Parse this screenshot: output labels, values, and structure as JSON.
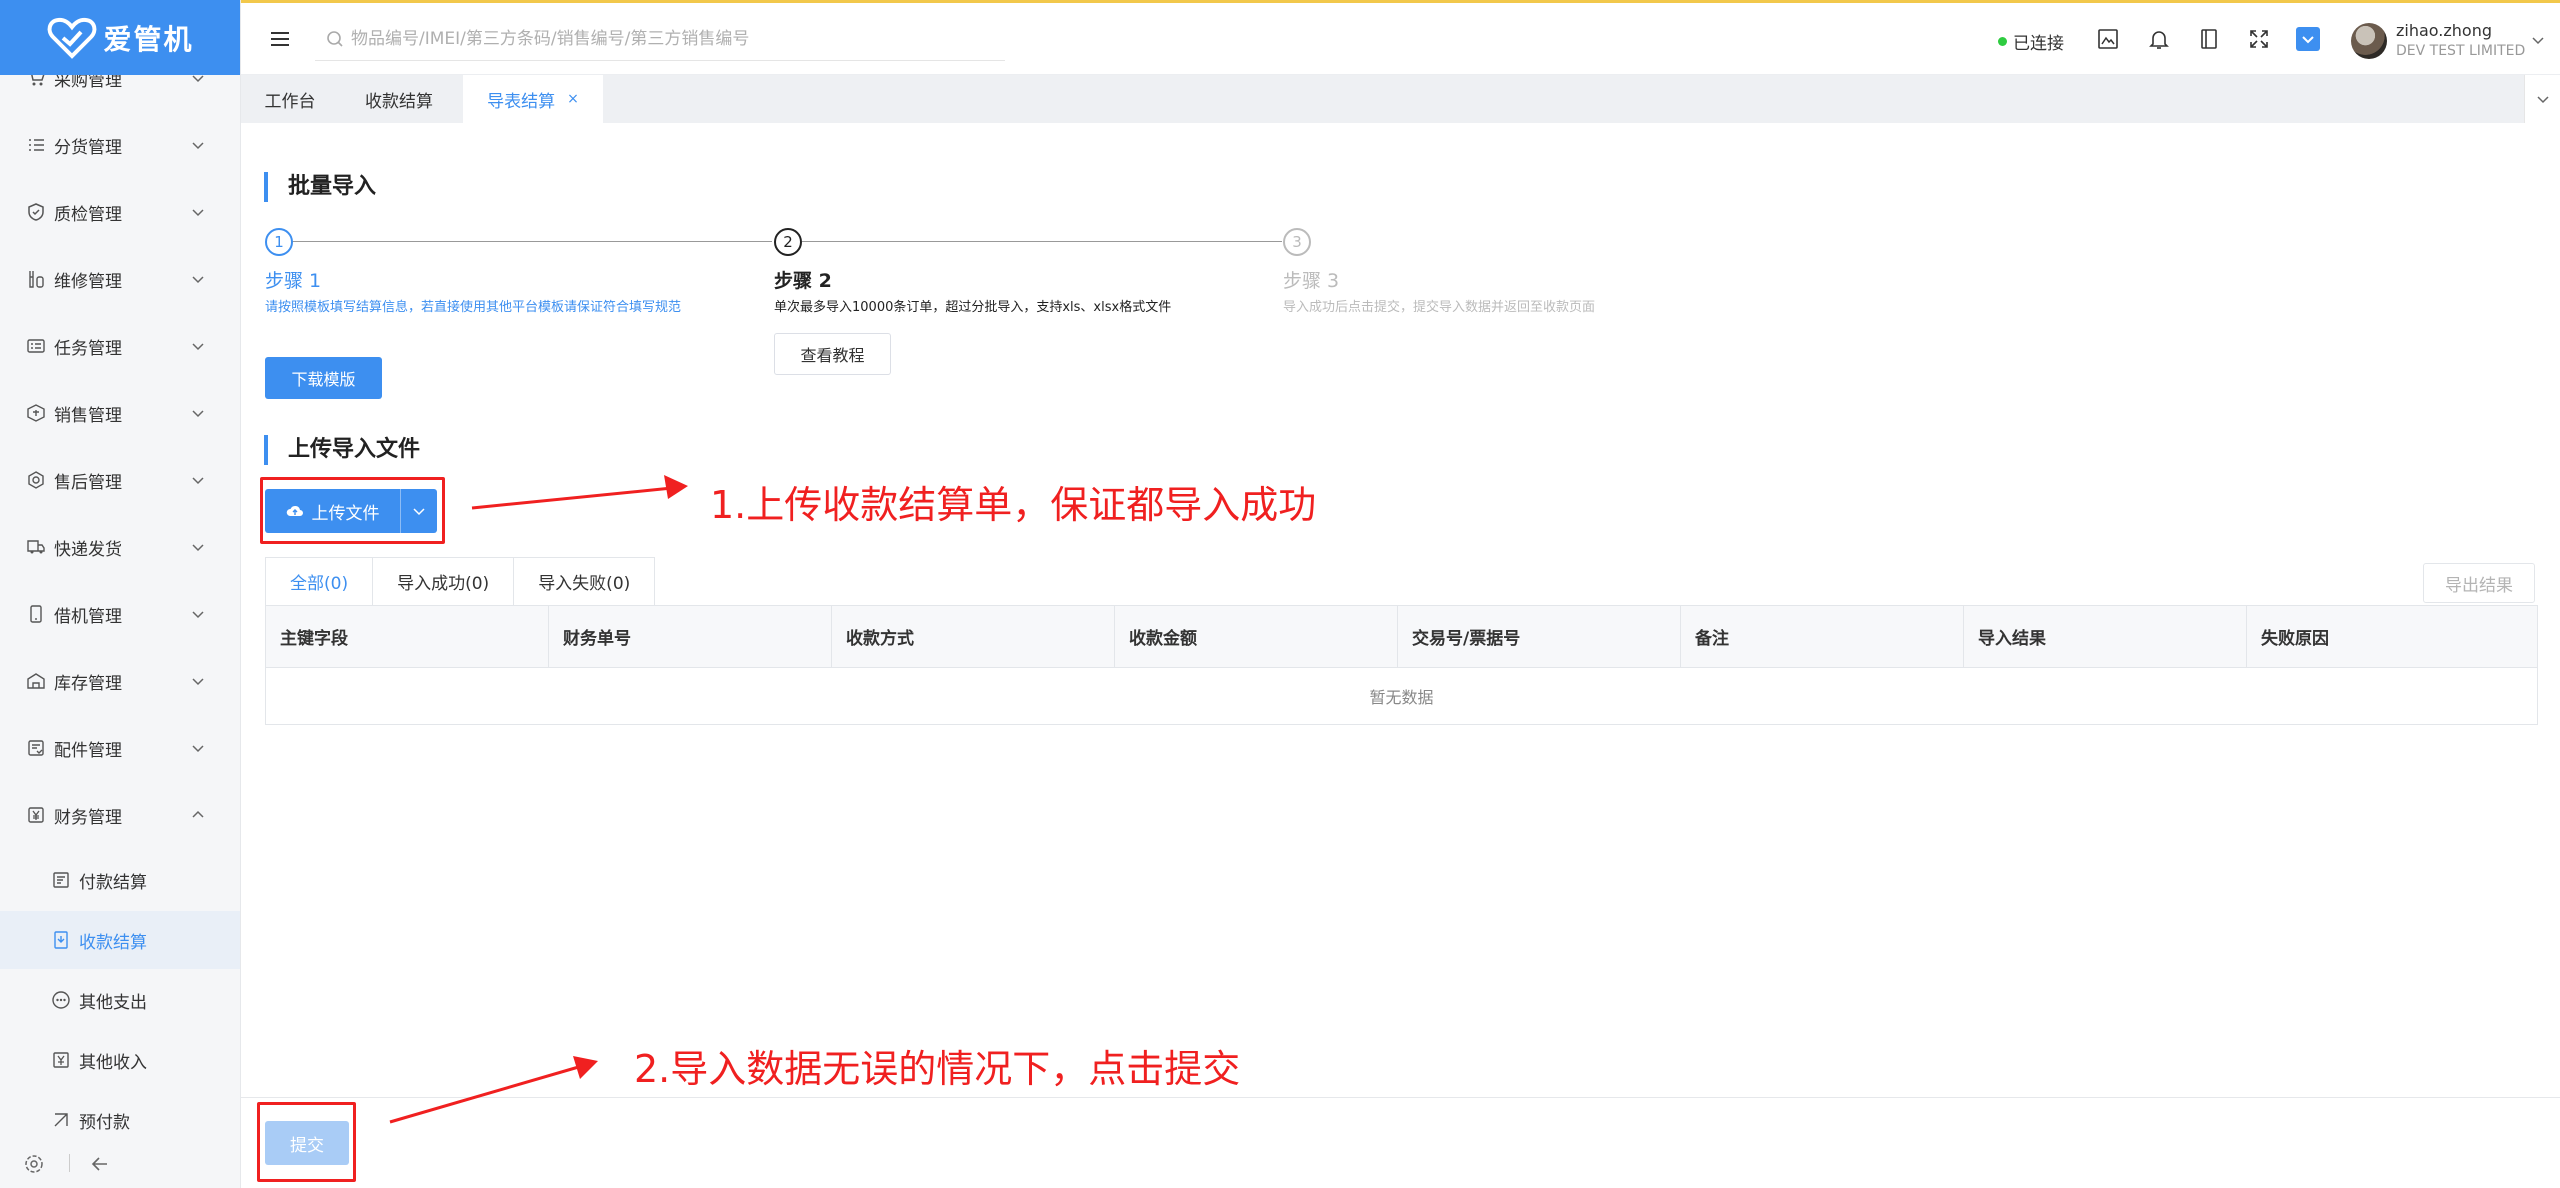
{
  "app": {
    "logo_text": "爱管机"
  },
  "search": {
    "placeholder": "物品编号/IMEI/第三方条码/销售编号/第三方销售编号"
  },
  "header": {
    "connection_status": "已连接",
    "user_name": "zihao.zhong",
    "user_org": "DEV TEST LIMITED"
  },
  "sidebar": {
    "items": [
      {
        "label": "采购管理",
        "icon": "cart-icon"
      },
      {
        "label": "分货管理",
        "icon": "list-icon"
      },
      {
        "label": "质检管理",
        "icon": "shield-check-icon"
      },
      {
        "label": "维修管理",
        "icon": "wrench-icon"
      },
      {
        "label": "任务管理",
        "icon": "task-card-icon"
      },
      {
        "label": "销售管理",
        "icon": "sales-icon"
      },
      {
        "label": "售后管理",
        "icon": "aftersale-icon"
      },
      {
        "label": "快递发货",
        "icon": "truck-icon"
      },
      {
        "label": "借机管理",
        "icon": "phone-icon"
      },
      {
        "label": "库存管理",
        "icon": "warehouse-icon"
      },
      {
        "label": "配件管理",
        "icon": "parts-icon"
      },
      {
        "label": "财务管理",
        "icon": "yuan-icon",
        "expanded": true
      }
    ],
    "sub_items": [
      {
        "label": "付款结算",
        "icon": "payment-icon"
      },
      {
        "label": "收款结算",
        "icon": "receipt-icon",
        "active": true
      },
      {
        "label": "其他支出",
        "icon": "dots-circle-icon"
      },
      {
        "label": "其他收入",
        "icon": "income-icon"
      },
      {
        "label": "预付款",
        "icon": "prepay-icon"
      }
    ]
  },
  "tabs": [
    {
      "label": "工作台"
    },
    {
      "label": "收款结算"
    },
    {
      "label": "导表结算",
      "active": true,
      "close": "×"
    }
  ],
  "batch_import": {
    "title": "批量导入",
    "steps": [
      {
        "num": "1",
        "title": "步骤 1",
        "desc": "请按照模板填写结算信息，若直接使用其他平台模板请保证符合填写规范",
        "button": "下载模版"
      },
      {
        "num": "2",
        "title": "步骤 2",
        "desc": "单次最多导入10000条订单，超过分批导入，支持xls、xlsx格式文件",
        "button": "查看教程"
      },
      {
        "num": "3",
        "title": "步骤 3",
        "desc": "导入成功后点击提交，提交导入数据并返回至收款页面"
      }
    ]
  },
  "upload_section": {
    "title": "上传导入文件",
    "upload_button": "上传文件",
    "result_tabs": [
      "全部(0)",
      "导入成功(0)",
      "导入失败(0)"
    ],
    "export_button": "导出结果",
    "columns": [
      "主键字段",
      "财务单号",
      "收款方式",
      "收款金额",
      "交易号/票据号",
      "备注",
      "导入结果",
      "失败原因"
    ],
    "empty_text": "暂无数据"
  },
  "footer": {
    "submit_button": "提交"
  },
  "annotations": {
    "note1": "1.上传收款结算单，保证都导入成功",
    "note2": "2.导入数据无误的情况下，点击提交",
    "color": "#f02020"
  },
  "colors": {
    "primary": "#3d8ff0",
    "disabled_primary": "#a9ccf6",
    "online": "#2ecc40"
  }
}
